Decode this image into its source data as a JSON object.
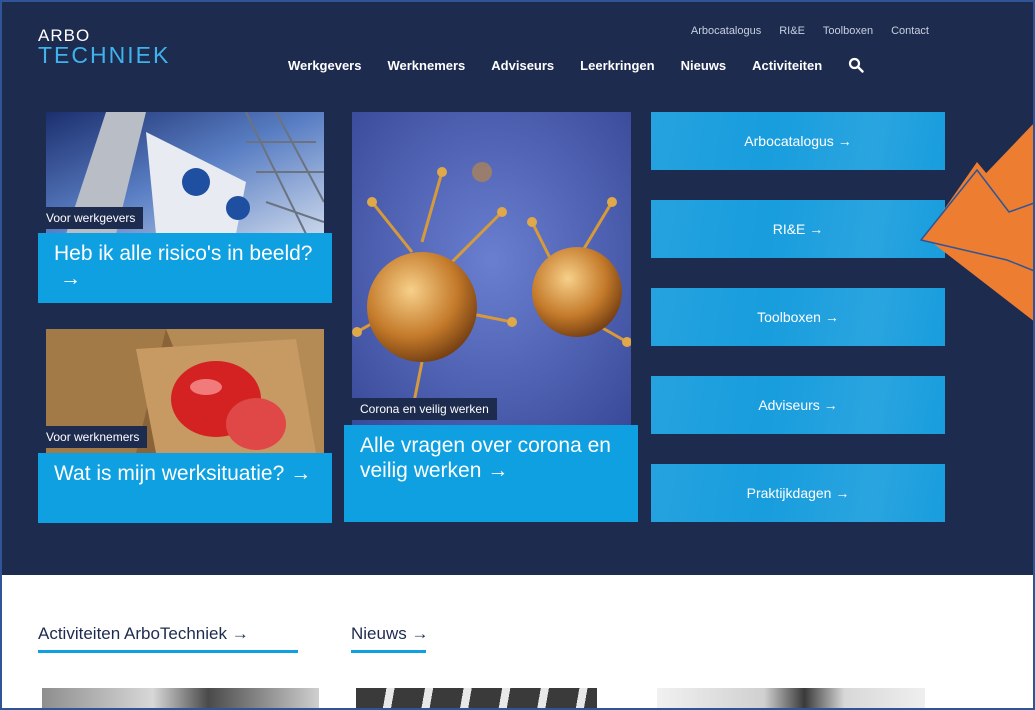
{
  "logo": {
    "line1": "ARBO",
    "line2": "TECHNIEK"
  },
  "top_links": [
    "Arbocatalogus",
    "RI&E",
    "Toolboxen",
    "Contact"
  ],
  "main_nav": [
    "Werkgevers",
    "Werknemers",
    "Adviseurs",
    "Leerkringen",
    "Nieuws",
    "Activiteiten"
  ],
  "cards": {
    "werkgevers": {
      "tag": "Voor werkgevers",
      "title": "Heb ik alle risico's in beeld?",
      "arrow": "→"
    },
    "werknemers": {
      "tag": "Voor werknemers",
      "title": "Wat is mijn werksituatie?",
      "arrow": "→"
    },
    "corona": {
      "tag": "Corona en veilig werken",
      "title": "Alle vragen over corona en veilig werken",
      "arrow": "→"
    }
  },
  "quick_links": [
    {
      "label": "Arbocatalogus →"
    },
    {
      "label": "RI&E →"
    },
    {
      "label": "Toolboxen →"
    },
    {
      "label": "Adviseurs →"
    },
    {
      "label": "Praktijkdagen →"
    }
  ],
  "sections": {
    "activiteiten": "Activiteiten ArboTechniek →",
    "nieuws": "Nieuws →"
  },
  "colors": {
    "navy": "#1d2b4f",
    "accent": "#0ea0e0",
    "annotation_arrow": "#ed7d31"
  }
}
